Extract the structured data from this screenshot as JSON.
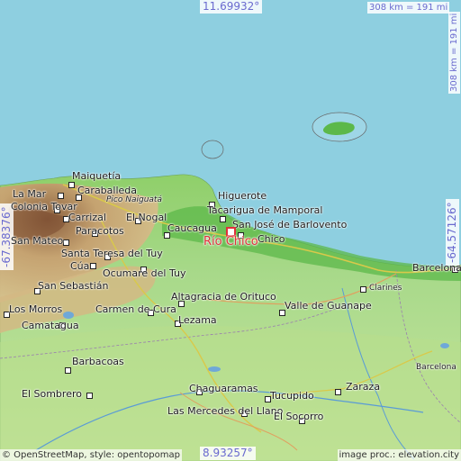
{
  "coords": {
    "top": "11.69932°",
    "bottom": "8.93257°",
    "left": "-67.38376°",
    "right": "-64.57126°"
  },
  "scale": {
    "horizontal": "308 km = 191 mi",
    "vertical": "308 km = 191 mi"
  },
  "highlight_place": "Río Chico",
  "places": [
    "Maiquetía",
    "Caraballeda",
    "Colonia Tovar",
    "La Mar",
    "Pico Naiguatá",
    "Carrizal",
    "El Nogal",
    "Paracotos",
    "San Mateo",
    "Santa Teresa del Tuy",
    "Cúa",
    "Ocumare del Tuy",
    "San Sebastián",
    "Los Morros",
    "Camatagua",
    "Carmen de Cura",
    "Lezama",
    "Altagracia de Orituco",
    "Barbacoas",
    "El Sombrero",
    "Chaguaramas",
    "Las Mercedes del Llano",
    "Tucupido",
    "Zaraza",
    "El Socorro",
    "Higuerote",
    "Tacarigua de Mamporal",
    "Caucagua",
    "San José de Barlovento",
    "Chico",
    "Valle de Guanape",
    "Clarines",
    "Barcelona",
    "Barcelona"
  ],
  "credits": {
    "left": "© OpenStreetMap, style: opentopomap",
    "right": "image proc.: elevation.city"
  }
}
